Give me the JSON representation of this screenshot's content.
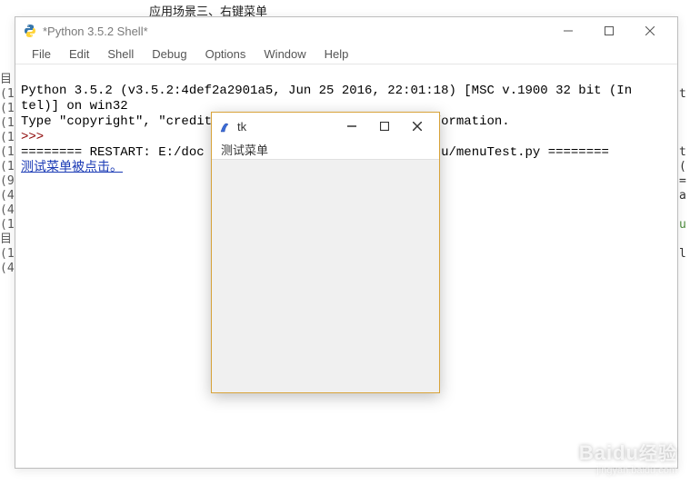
{
  "fragments": {
    "top_label": "应用场景三、右键菜单"
  },
  "main_window": {
    "title": "*Python 3.5.2 Shell*",
    "menubar": [
      "File",
      "Edit",
      "Shell",
      "Debug",
      "Options",
      "Window",
      "Help"
    ]
  },
  "console": {
    "line1": "Python 3.5.2 (v3.5.2:4def2a2901a5, Jun 25 2016, 22:01:18) [MSC v.1900 32 bit (In",
    "line2": "tel)] on win32",
    "line3": "Type \"copyright\", \"credits\" or \"license()\" for more information.",
    "prompt": ">>>",
    "restart_left": "======== RESTART: E:/doc",
    "restart_right": "enu/menuTest.py ========",
    "output": "测试菜单被点击。"
  },
  "tk_window": {
    "title": "tk",
    "menu_item": "测试菜单"
  },
  "watermark": {
    "brand_en": "Baidu",
    "brand_cn": "经验",
    "url": "jingyan.baidu.com"
  },
  "left_gutter_chars": [
    "目",
    "(",
    "(",
    "(",
    "(",
    "(",
    "(",
    "(9",
    "(4",
    "(4",
    "(",
    "目",
    "(",
    "(4"
  ],
  "right_gutter_chars": [
    "t",
    "",
    "",
    "",
    "",
    "t",
    "(",
    "=",
    "a",
    "",
    "u",
    "",
    "l",
    ""
  ]
}
